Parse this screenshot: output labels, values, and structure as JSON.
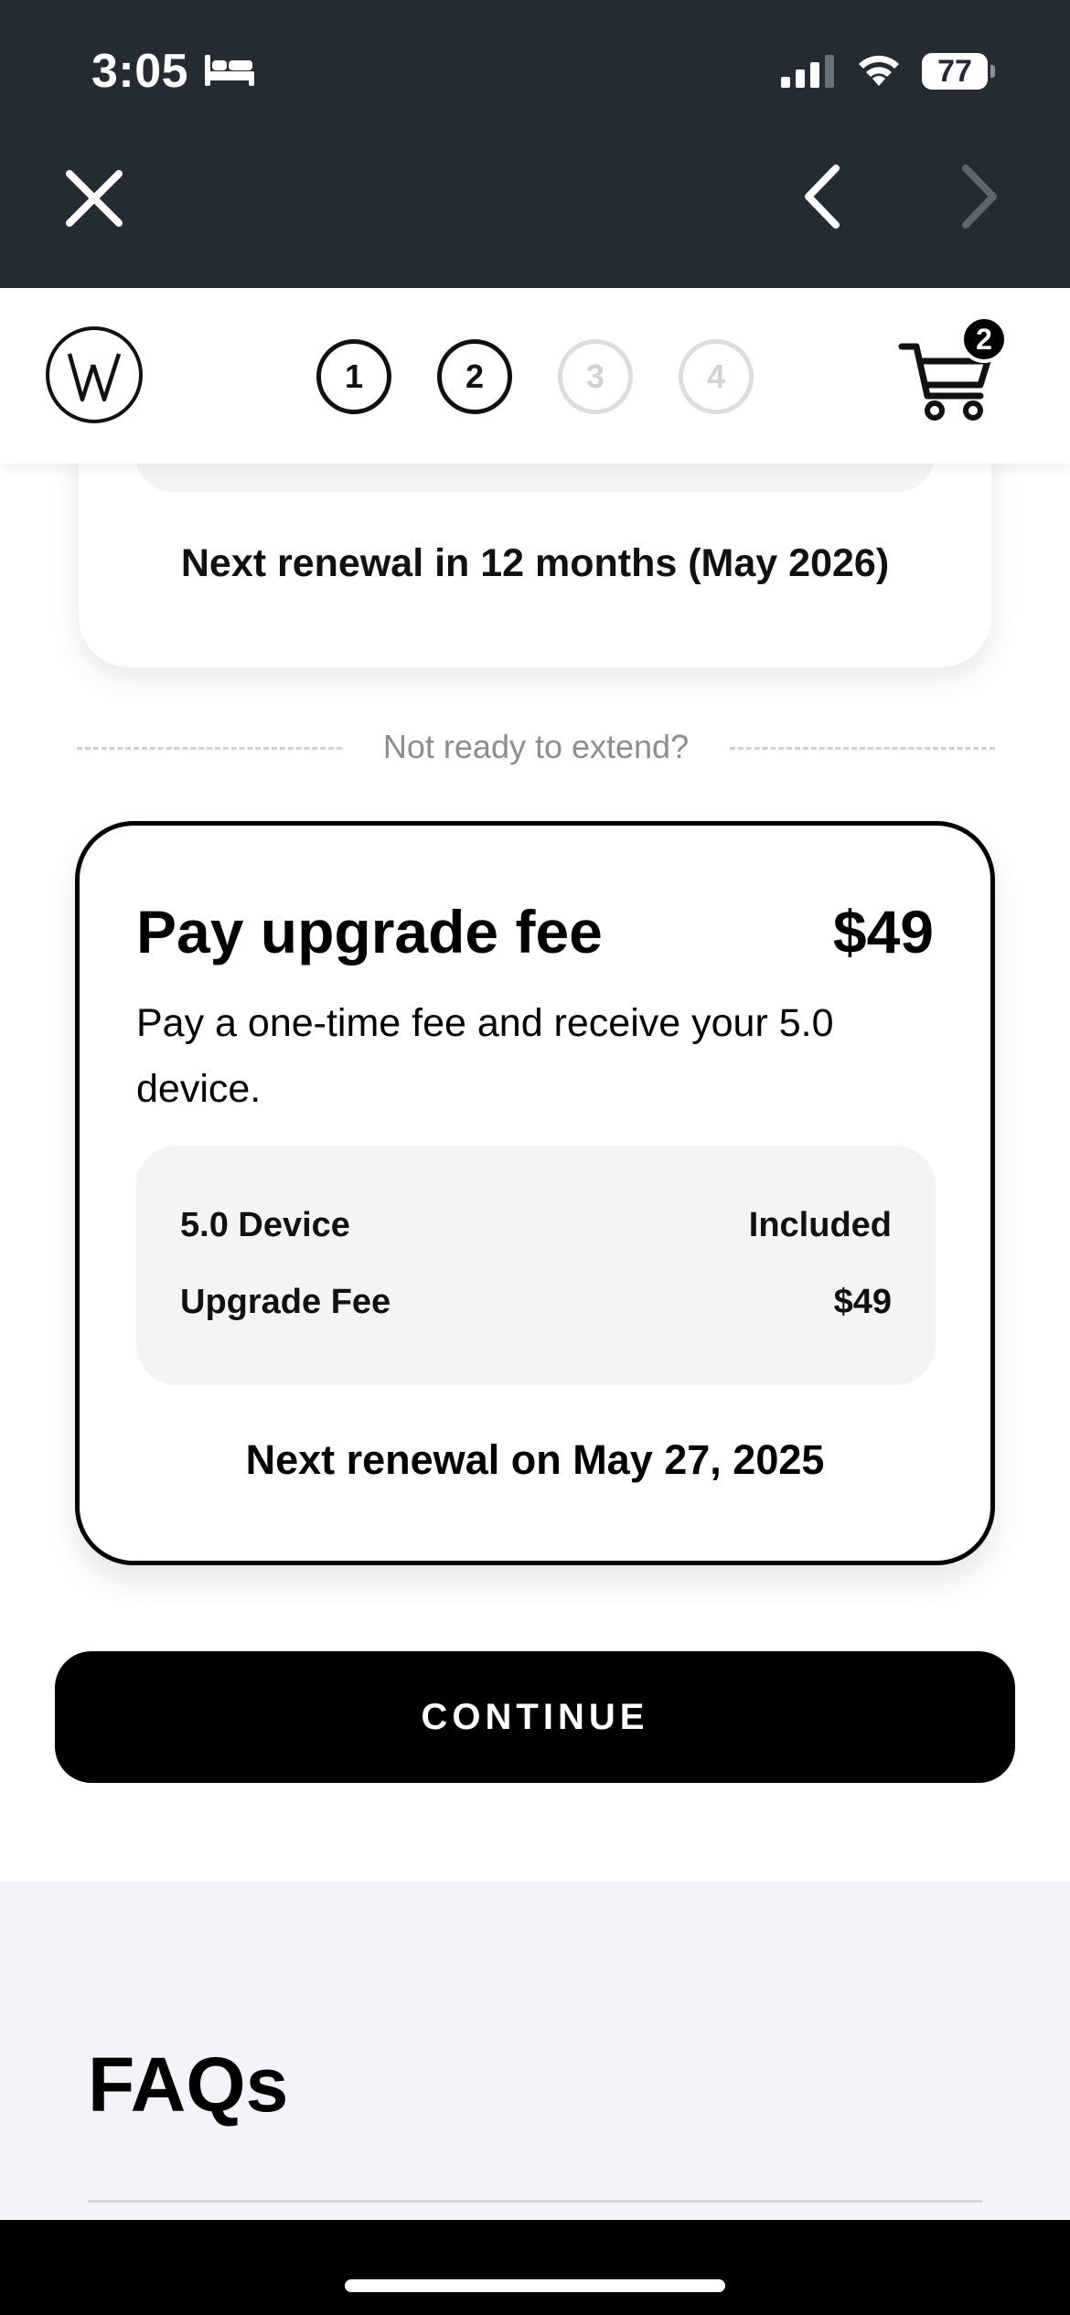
{
  "status_bar": {
    "time": "3:05",
    "battery": "77",
    "icons": [
      "bed-icon",
      "signal-icon",
      "wifi-icon",
      "battery-icon"
    ]
  },
  "browser_bar": {
    "icons": [
      "close-icon",
      "chevron-left-icon",
      "chevron-right-icon"
    ]
  },
  "header": {
    "logo_icon": "whoop-logo-icon",
    "steps": [
      {
        "label": "1",
        "state": "completed"
      },
      {
        "label": "2",
        "state": "current"
      },
      {
        "label": "3",
        "state": "inactive"
      },
      {
        "label": "4",
        "state": "inactive"
      }
    ],
    "cart_icon": "cart-icon",
    "cart_count": "2"
  },
  "previous_option": {
    "renewal_text": "Next renewal in 12 months (May 2026)"
  },
  "divider": {
    "text": "Not ready to extend?"
  },
  "upgrade_option": {
    "title": "Pay upgrade fee",
    "price": "$49",
    "description": "Pay a one-time fee and receive your 5.0 device.",
    "rows": [
      {
        "label": "5.0 Device",
        "value": "Included"
      },
      {
        "label": "Upgrade Fee",
        "value": "$49"
      }
    ],
    "renewal_text": "Next renewal on May 27, 2025"
  },
  "continue_button": {
    "label": "CONTINUE"
  },
  "faq": {
    "title": "FAQs"
  },
  "colors": {
    "top_bar": "#252b32",
    "accent": "#000000",
    "card_inner": "#f4f4f4",
    "faq_background": "#f3f4f8",
    "inactive_step": "#dcdcdc"
  }
}
